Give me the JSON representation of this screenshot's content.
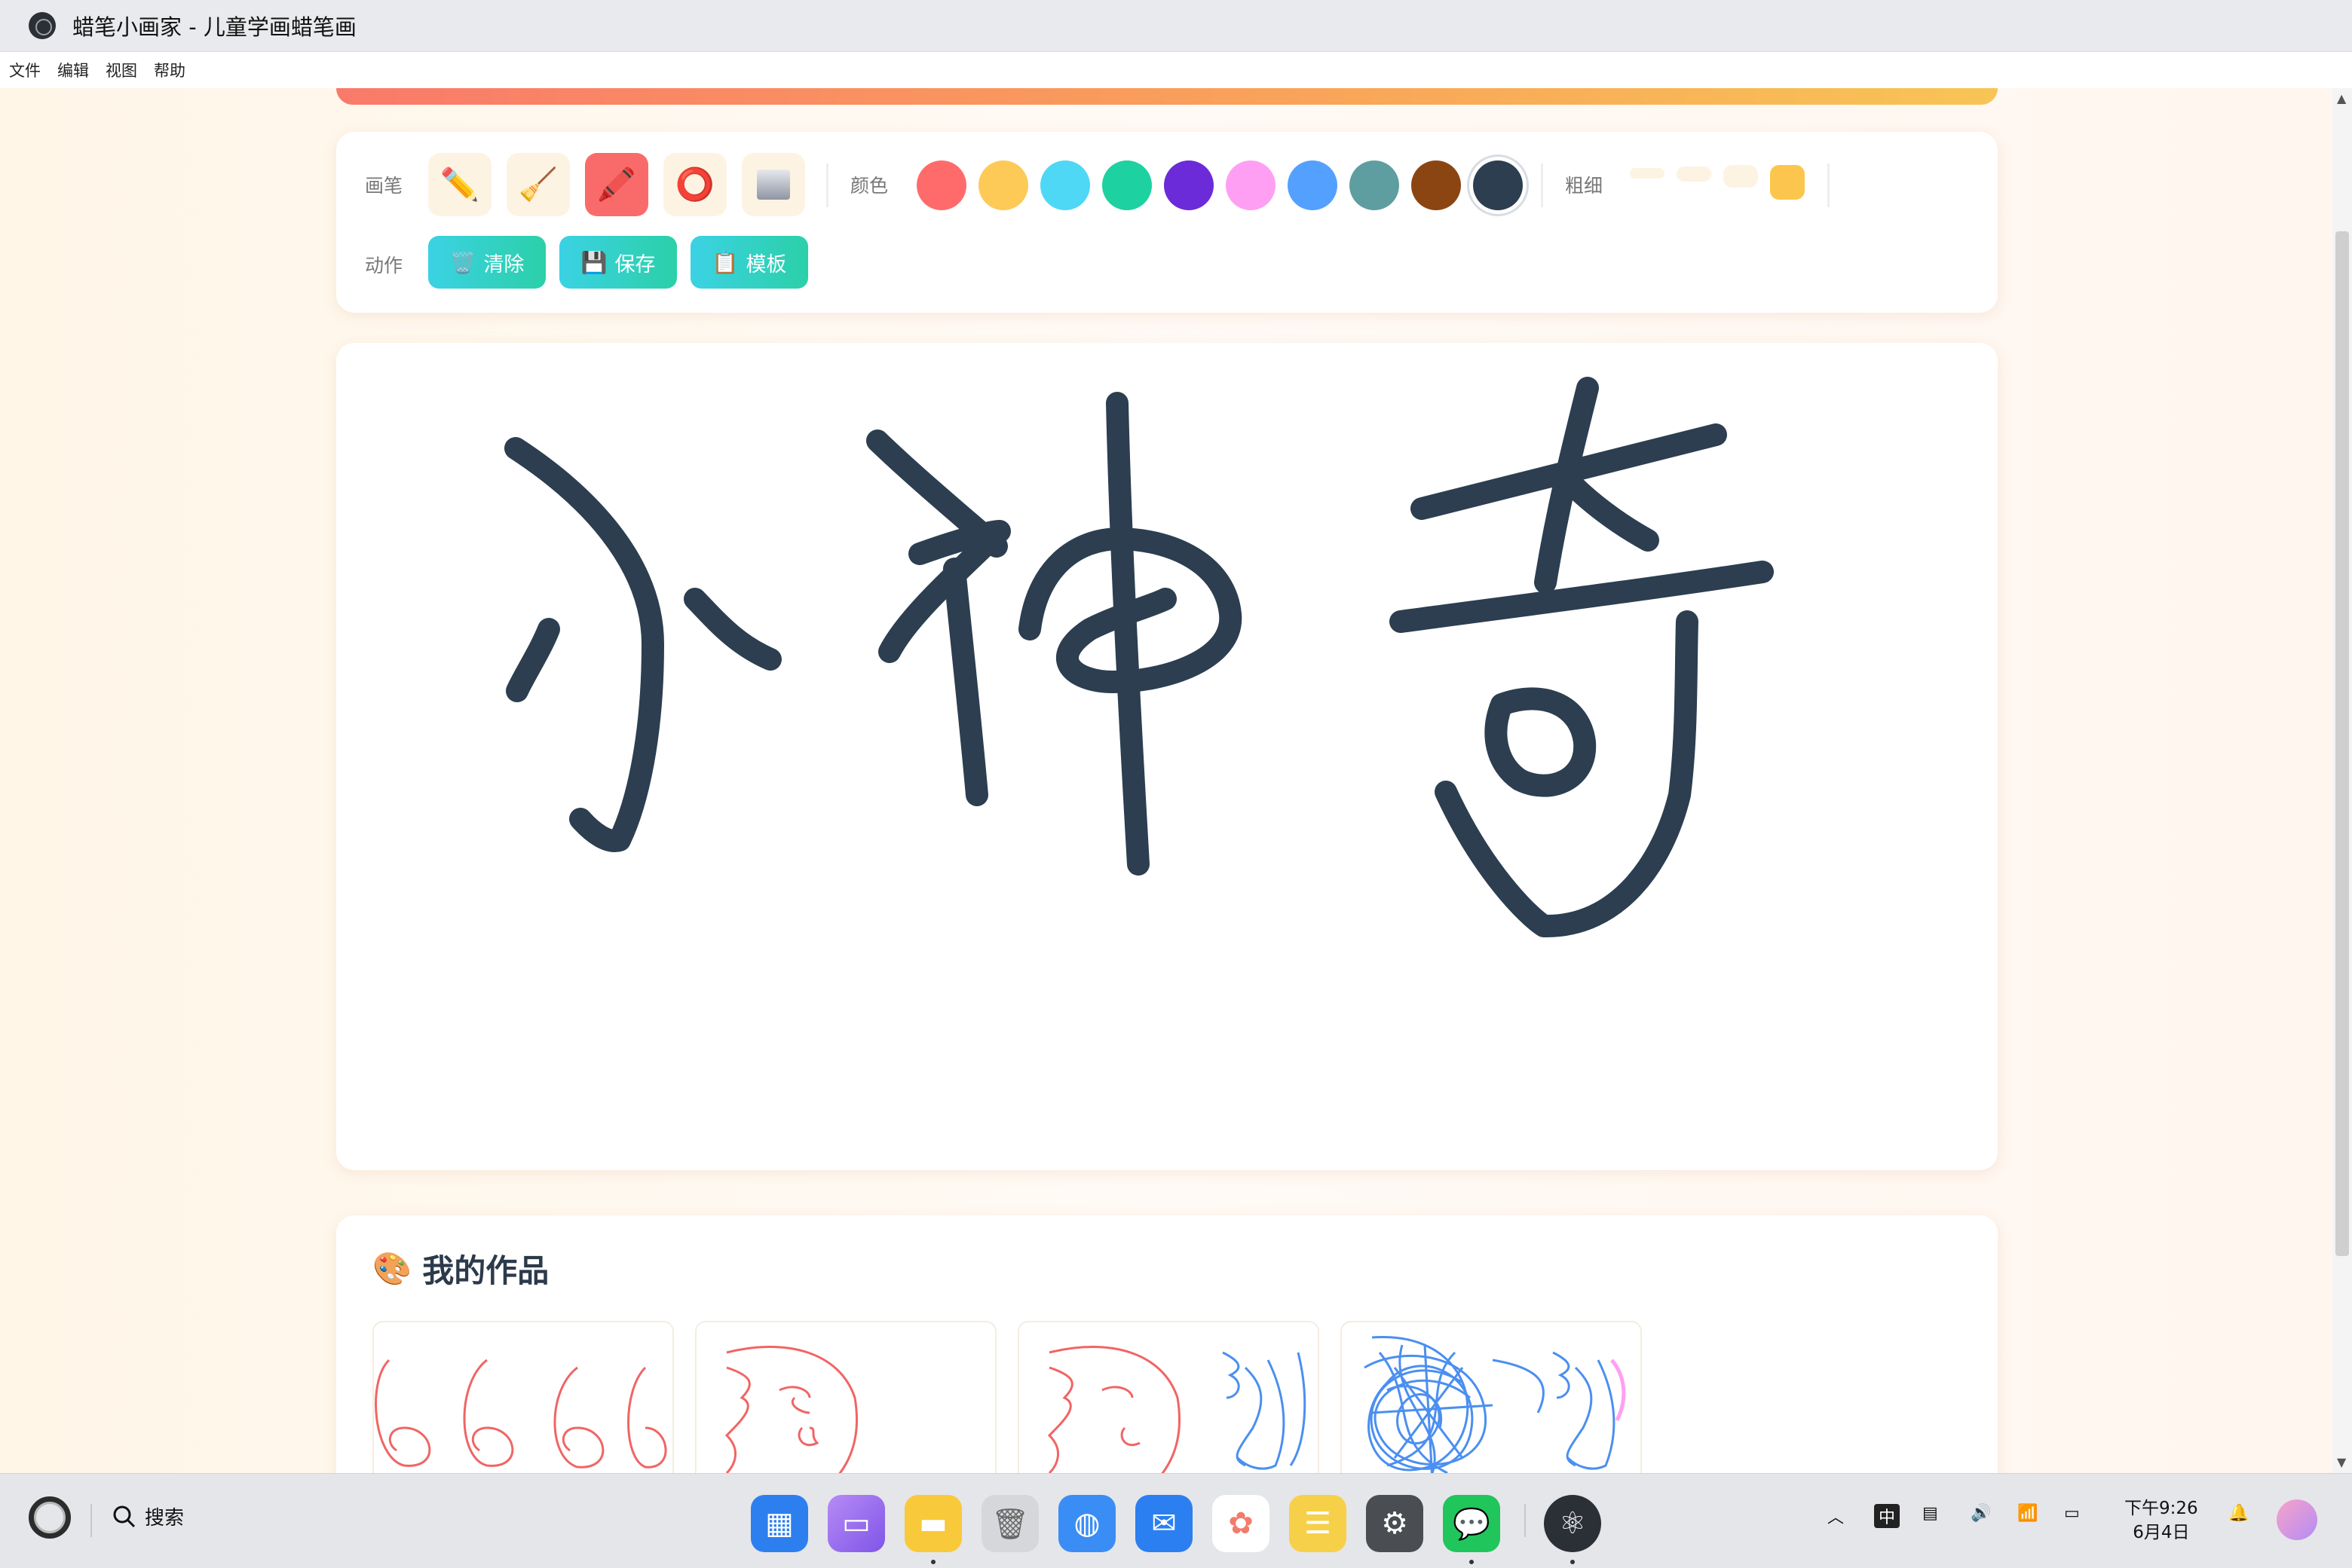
{
  "window": {
    "title": "蜡笔小画家 - 儿童学画蜡笔画"
  },
  "menu": [
    "文件",
    "编辑",
    "视图",
    "帮助"
  ],
  "toolbar": {
    "brush_label": "画笔",
    "color_label": "颜色",
    "thickness_label": "粗细",
    "action_label": "动作",
    "tools": [
      {
        "name": "pencil",
        "glyph": "✏️",
        "selected": false
      },
      {
        "name": "broom",
        "glyph": "🧹",
        "selected": false
      },
      {
        "name": "crayon",
        "glyph": "🖍️",
        "selected": true
      },
      {
        "name": "circle",
        "glyph": "⭕",
        "selected": false
      },
      {
        "name": "fill",
        "glyph": "▦",
        "selected": false
      }
    ],
    "colors": [
      "#ff6b6b",
      "#fdca57",
      "#4ed8f5",
      "#1dd1a1",
      "#6c2bd9",
      "#ff9ff3",
      "#54a0ff",
      "#5f9ea0",
      "#8b4513",
      "#2c3e50"
    ],
    "selected_color": "#2c3e50",
    "thickness_selected_index": 3,
    "actions": [
      {
        "icon": "🗑️",
        "label": "清除"
      },
      {
        "icon": "💾",
        "label": "保存"
      },
      {
        "icon": "📋",
        "label": "模板"
      }
    ]
  },
  "canvas": {
    "stroke_color": "#2c3e50"
  },
  "works": {
    "icon": "🎨",
    "title": "我的作品"
  },
  "taskbar": {
    "search_label": "搜索",
    "tray_input": "中",
    "time": "下午9:26",
    "date": "6月4日"
  }
}
